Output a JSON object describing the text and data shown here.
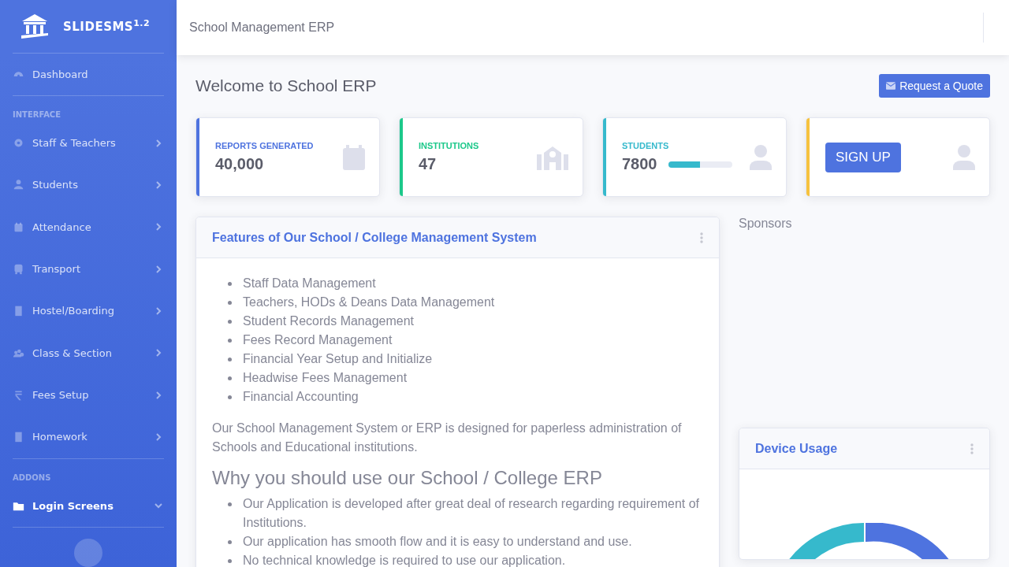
{
  "brand": {
    "name": "SLIDESMS",
    "version": "1.2"
  },
  "sidebar": {
    "items": [
      {
        "kind": "link",
        "label": "Dashboard",
        "selected": false
      },
      {
        "kind": "heading",
        "label": "INTERFACE"
      },
      {
        "kind": "group",
        "label": "Staff & Teachers",
        "selected": false,
        "expanded": false
      },
      {
        "kind": "group",
        "label": "Students",
        "selected": false,
        "expanded": false
      },
      {
        "kind": "group",
        "label": "Attendance",
        "selected": false,
        "expanded": false
      },
      {
        "kind": "group",
        "label": "Transport",
        "selected": false,
        "expanded": false
      },
      {
        "kind": "group",
        "label": "Hostel/Boarding",
        "selected": false,
        "expanded": false
      },
      {
        "kind": "group",
        "label": "Class & Section",
        "selected": false,
        "expanded": false
      },
      {
        "kind": "group",
        "label": "Fees Setup",
        "selected": false,
        "expanded": false
      },
      {
        "kind": "group",
        "label": "Homework",
        "selected": false,
        "expanded": false
      },
      {
        "kind": "heading",
        "label": "ADDONS"
      },
      {
        "kind": "group",
        "label": "Login Screens",
        "selected": true,
        "expanded": true
      }
    ]
  },
  "topbar": {
    "title": "School Management ERP"
  },
  "page": {
    "heading": "Welcome to School ERP",
    "action": "Request a Quote"
  },
  "stat_cards": [
    {
      "kind": "stat",
      "label": "REPORTS GENERATED",
      "value": "40,000",
      "color": "#4e73df"
    },
    {
      "kind": "stat",
      "label": "INSTITUTIONS",
      "value": "47",
      "color": "#1cc88a"
    },
    {
      "kind": "progress",
      "label": "STUDENTS",
      "value": "7800",
      "level": 0.5,
      "color": "#36b9cc"
    },
    {
      "kind": "button",
      "button": "SIGN UP",
      "color": "#f6c23e"
    }
  ],
  "features": {
    "title": "Features of Our School / College Management System",
    "items": [
      "Staff Data Management",
      "Teachers, HODs & Deans Data Management",
      "Student Records Management",
      "Fees Record Management",
      "Financial Year Setup and Initialize",
      "Headwise Fees Management",
      "Financial Accounting"
    ],
    "paragraph": "Our School Management System or ERP is designed for paperless administration of Schools and Educational institutions.",
    "subheading": "Why you should use our School / College ERP",
    "reasons": [
      "Our Application is developed after great deal of research regarding requirement of Institutions.",
      "Our application has smooth flow and it is easy to understand and use.",
      "No technical knowledge is required to use our application."
    ]
  },
  "sponsors": {
    "title": "Sponsors"
  },
  "device_usage": {
    "title": "Device Usage"
  }
}
